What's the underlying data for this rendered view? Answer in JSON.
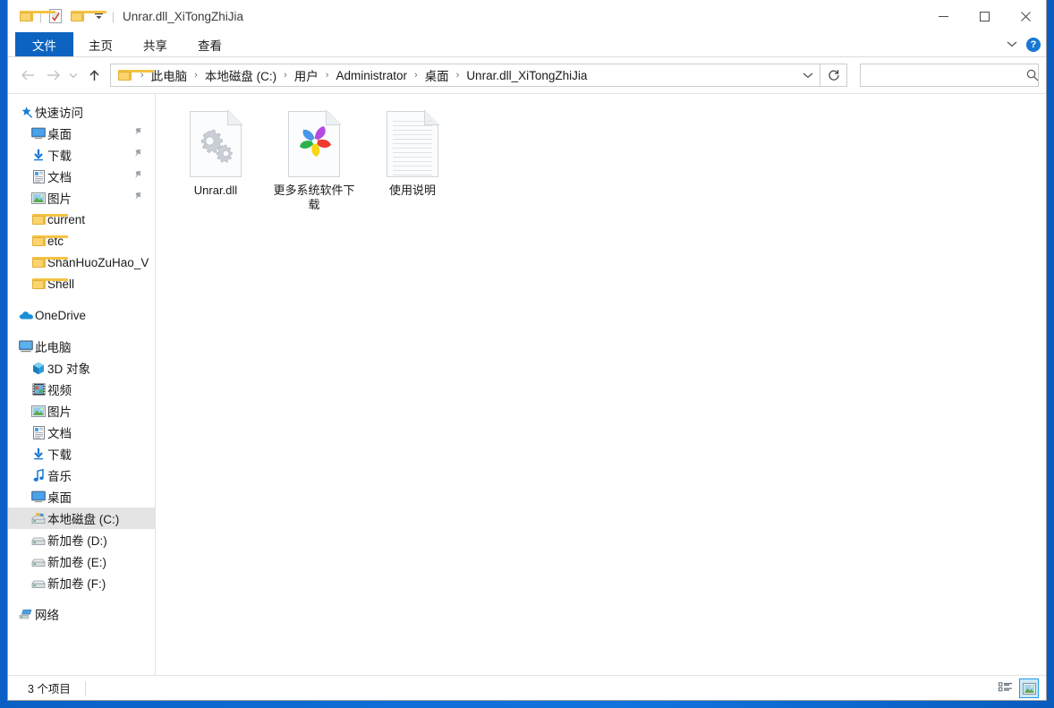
{
  "window": {
    "title": "Unrar.dll_XiTongZhiJia",
    "accent_color": "#0c64c0",
    "quick_access": [
      {
        "name": "folder-icon",
        "label": "文件夹"
      },
      {
        "name": "properties-icon",
        "label": "属性"
      },
      {
        "name": "new-folder-icon",
        "label": "新建文件夹"
      }
    ],
    "controls": {
      "minimize": "—",
      "maximize": "☐",
      "close": "✕"
    }
  },
  "ribbon": {
    "tabs": [
      {
        "label": "文件",
        "active": true
      },
      {
        "label": "主页",
        "active": false
      },
      {
        "label": "共享",
        "active": false
      },
      {
        "label": "查看",
        "active": false
      }
    ],
    "expand_icon": "⌄",
    "help_icon": "?"
  },
  "address_bar": {
    "back_icon": "←",
    "forward_icon": "→",
    "history_icon": "⌄",
    "up_icon": "↑",
    "breadcrumbs": [
      "此电脑",
      "本地磁盘 (C:)",
      "用户",
      "Administrator",
      "桌面",
      "Unrar.dll_XiTongZhiJia"
    ],
    "separator": "›",
    "path_dropdown_icon": "⌄",
    "refresh_icon": "↻",
    "search": {
      "value": "",
      "placeholder": "",
      "icon": "⌕"
    }
  },
  "sidebar": {
    "groups": [
      {
        "header": {
          "label": "快速访问",
          "icon": "star-pin-icon"
        },
        "items": [
          {
            "label": "桌面",
            "icon": "desktop-icon",
            "pinned": true
          },
          {
            "label": "下载",
            "icon": "downloads-icon",
            "pinned": true
          },
          {
            "label": "文档",
            "icon": "documents-icon",
            "pinned": true
          },
          {
            "label": "图片",
            "icon": "pictures-icon",
            "pinned": true
          },
          {
            "label": "current",
            "icon": "folder-icon",
            "pinned": false
          },
          {
            "label": "etc",
            "icon": "folder-icon",
            "pinned": false
          },
          {
            "label": "ShanHuoZuHao_V",
            "icon": "folder-icon",
            "pinned": false
          },
          {
            "label": "Shell",
            "icon": "folder-icon",
            "pinned": false
          }
        ]
      },
      {
        "header": {
          "label": "OneDrive",
          "icon": "onedrive-cloud-icon"
        },
        "items": []
      },
      {
        "header": {
          "label": "此电脑",
          "icon": "this-pc-icon"
        },
        "items": [
          {
            "label": "3D 对象",
            "icon": "3d-objects-icon"
          },
          {
            "label": "视频",
            "icon": "videos-icon"
          },
          {
            "label": "图片",
            "icon": "pictures-icon"
          },
          {
            "label": "文档",
            "icon": "documents-icon"
          },
          {
            "label": "下载",
            "icon": "downloads-icon"
          },
          {
            "label": "音乐",
            "icon": "music-icon"
          },
          {
            "label": "桌面",
            "icon": "desktop-icon"
          },
          {
            "label": "本地磁盘 (C:)",
            "icon": "system-drive-icon",
            "selected": true
          },
          {
            "label": "新加卷 (D:)",
            "icon": "drive-icon"
          },
          {
            "label": "新加卷 (E:)",
            "icon": "drive-icon"
          },
          {
            "label": "新加卷 (F:)",
            "icon": "drive-icon"
          }
        ]
      },
      {
        "header": {
          "label": "网络",
          "icon": "network-icon"
        },
        "items": []
      }
    ]
  },
  "files": [
    {
      "name": "Unrar.dll",
      "icon": "dll-gears-file-icon"
    },
    {
      "name": "更多系统软件下载",
      "icon": "pinwheel-shortcut-file-icon"
    },
    {
      "name": "使用说明",
      "icon": "text-document-file-icon"
    }
  ],
  "status_bar": {
    "item_count_text": "3 个项目",
    "views": [
      {
        "name": "details-view",
        "active": false
      },
      {
        "name": "large-icons-view",
        "active": true
      }
    ]
  }
}
